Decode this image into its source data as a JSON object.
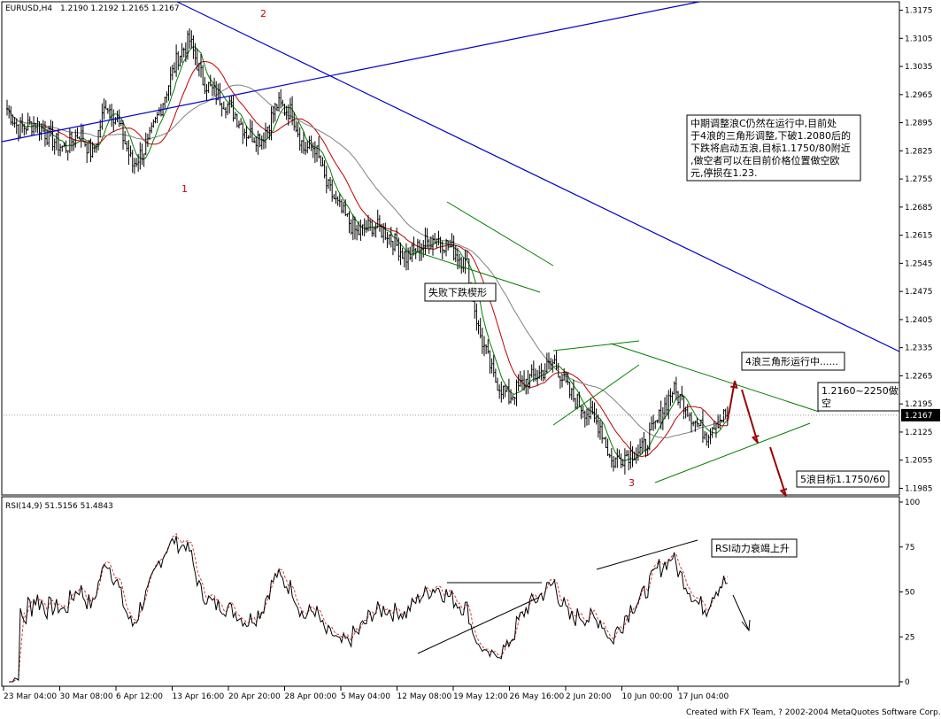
{
  "chart_data": [
    {
      "type": "candlestick",
      "symbol": "EURUSD,H4",
      "ohlc_header": "1.2190 1.2192 1.2165 1.2167",
      "y_ticks": [
        "1.3175",
        "1.3105",
        "1.3035",
        "1.2965",
        "1.2895",
        "1.2825",
        "1.2755",
        "1.2685",
        "1.2615",
        "1.2545",
        "1.2475",
        "1.2405",
        "1.2335",
        "1.2265",
        "1.2195",
        "1.2125",
        "1.2055",
        "1.1985"
      ],
      "ylim": [
        1.1975,
        1.3185
      ],
      "current_price": "1.2167",
      "x_ticks": [
        "23 Mar 04:00",
        "30 Mar 08:00",
        "6 Apr 12:00",
        "13 Apr 16:00",
        "20 Apr 20:00",
        "28 Apr 00:00",
        "5 May 04:00",
        "12 May 08:00",
        "19 May 12:00",
        "26 May 16:00",
        "2 Jun 20:00",
        "10 Jun 00:00",
        "17 Jun 04:00"
      ],
      "wave_labels": [
        "1",
        "2",
        "3"
      ],
      "close_anchors": [
        [
          0,
          1.293
        ],
        [
          6,
          1.288
        ],
        [
          15,
          1.2895
        ],
        [
          22,
          1.286
        ],
        [
          30,
          1.283
        ],
        [
          38,
          1.287
        ],
        [
          45,
          1.2815
        ],
        [
          52,
          1.2945
        ],
        [
          58,
          1.29
        ],
        [
          66,
          1.279
        ],
        [
          74,
          1.284
        ],
        [
          82,
          1.295
        ],
        [
          90,
          1.306
        ],
        [
          96,
          1.31
        ],
        [
          103,
          1.3
        ],
        [
          110,
          1.2965
        ],
        [
          118,
          1.293
        ],
        [
          126,
          1.287
        ],
        [
          134,
          1.2855
        ],
        [
          142,
          1.294
        ],
        [
          150,
          1.292
        ],
        [
          156,
          1.283
        ],
        [
          162,
          1.2835
        ],
        [
          168,
          1.274
        ],
        [
          175,
          1.268
        ],
        [
          184,
          1.262
        ],
        [
          192,
          1.264
        ],
        [
          200,
          1.262
        ],
        [
          210,
          1.256
        ],
        [
          218,
          1.259
        ],
        [
          226,
          1.261
        ],
        [
          234,
          1.258
        ],
        [
          242,
          1.254
        ],
        [
          248,
          1.238
        ],
        [
          256,
          1.226
        ],
        [
          264,
          1.221
        ],
        [
          272,
          1.225
        ],
        [
          280,
          1.227
        ],
        [
          288,
          1.23
        ],
        [
          296,
          1.222
        ],
        [
          304,
          1.218
        ],
        [
          312,
          1.214
        ],
        [
          318,
          1.205
        ],
        [
          326,
          1.207
        ],
        [
          334,
          1.208
        ],
        [
          342,
          1.215
        ],
        [
          350,
          1.223
        ],
        [
          356,
          1.22
        ],
        [
          362,
          1.215
        ],
        [
          368,
          1.212
        ],
        [
          372,
          1.215
        ],
        [
          378,
          1.2167
        ]
      ],
      "rsi": {
        "label": "RSI(14,9) 51.5156 51.4843",
        "ticks": [
          "100",
          "75",
          "50",
          "25",
          "0"
        ],
        "ylim": [
          0,
          100
        ]
      }
    }
  ],
  "annotations": {
    "note_main": [
      "中期调整浪C仍然在运行中,目前处",
      "于4浪的三角形调整,下破1.2080后的",
      "下跌将启动五浪,目标1.1750/80附近",
      ",做空者可以在目前价格位置做空欧",
      "元,停损在1.23."
    ],
    "wedge_label": "失败下跌楔形",
    "triangle_label": "4浪三角形运行中......",
    "short_label": [
      "1.2160~2250做",
      "空"
    ],
    "target_label": "5浪目标1.1750/60",
    "rsi_label": "RSI动力衰竭上升"
  },
  "footer": "Created with FX Team, ? 2002-2004 MetaQuotes Software Corp.",
  "colors": {
    "candles": "#000000",
    "trend_blue": "#0000cc",
    "pattern_green": "#008000",
    "ma_fast": "#008000",
    "ma_mid": "#c00000",
    "ma_slow": "#808080",
    "rsi_line": "#000000",
    "rsi_signal": "#d04040",
    "arrows": "#990000",
    "current_price_box": "#000000"
  }
}
